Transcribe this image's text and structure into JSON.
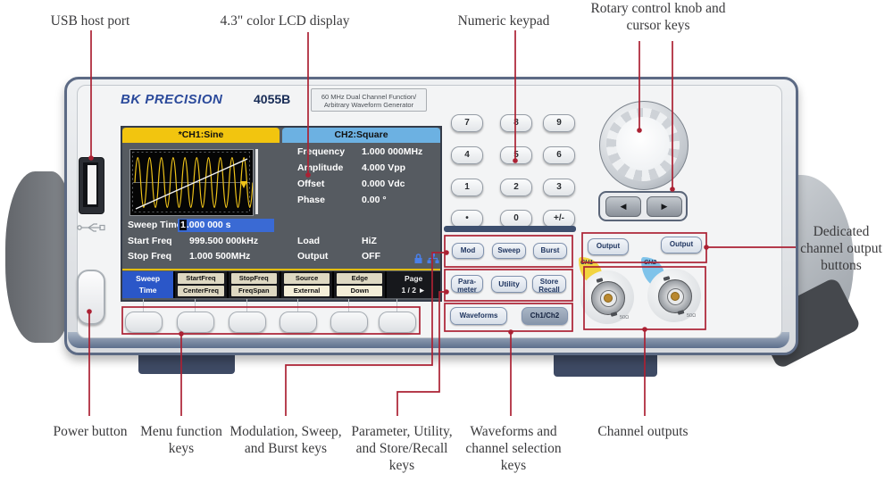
{
  "colors": {
    "annotation": "#ab2133",
    "lcd_tab_ch1": "#f2c50f",
    "lcd_tab_ch2": "#6cb1e2",
    "softkey_selected": "#2b57c8",
    "softkey_chip": "#ded8c2",
    "value_highlight": "#3a6ad4",
    "waveform": "#f0c419"
  },
  "callouts": {
    "usb": "USB host port",
    "lcd": "4.3\" color LCD display",
    "keypad": "Numeric keypad",
    "knob": "Rotary control knob and cursor keys",
    "power": "Power button",
    "menu": "Menu function keys",
    "mod": "Modulation, Sweep, and Burst keys",
    "parameter": "Parameter, Utility, and Store/Recall keys",
    "waveforms": "Waveforms and channel selection keys",
    "channel_outputs": "Channel outputs",
    "dedicated": "Dedicated channel output buttons"
  },
  "device": {
    "brand": "BK PRECISION",
    "model": "4055B",
    "subtitle_line1": "60 MHz Dual Channel Function/",
    "subtitle_line2": "Arbitrary Waveform Generator"
  },
  "lcd": {
    "tab_ch1": "*CH1:Sine",
    "tab_ch2": "CH2:Square",
    "params": [
      {
        "label": "Frequency",
        "value": "1.000 000MHz"
      },
      {
        "label": "Amplitude",
        "value": "4.000 Vpp"
      },
      {
        "label": "Offset",
        "value": "0.000 Vdc"
      },
      {
        "label": "Phase",
        "value": "0.00 °"
      }
    ],
    "sweep_time_label": "Sweep Time",
    "sweep_time_cursor": "1",
    "sweep_time_rest": ".000 000 s",
    "row2": {
      "label": "Start Freq",
      "value": "999.500 000kHz",
      "label2": "Load",
      "value2": "HiZ"
    },
    "row3": {
      "label": "Stop Freq",
      "value": "1.000 500MHz",
      "label2": "Output",
      "value2": "OFF"
    },
    "softkeys": [
      {
        "top": "Sweep",
        "bottom": "Time"
      },
      {
        "top": "StartFreq",
        "bottom": "CenterFreq"
      },
      {
        "top": "StopFreq",
        "bottom": "FreqSpan"
      },
      {
        "top": "Source",
        "bottom": "External"
      },
      {
        "top": "Edge",
        "bottom": "Down"
      },
      {
        "top": "Page",
        "bottom": "1 / 2  ►"
      }
    ]
  },
  "keypad": {
    "keys": [
      [
        "7",
        "8",
        "9"
      ],
      [
        "4",
        "5",
        "6"
      ],
      [
        "1",
        "2",
        "3"
      ],
      [
        "•",
        "0",
        "+/-"
      ]
    ]
  },
  "cursor": {
    "left": "◀",
    "right": "▶"
  },
  "function_keys": {
    "row1": [
      "Mod",
      "Sweep",
      "Burst"
    ],
    "row2_1a": "Para-",
    "row2_1b": "meter",
    "row2_2": "Utility",
    "row2_3a": "Store",
    "row2_3b": "Recall",
    "row3_1": "Waveforms",
    "row3_2": "Ch1/Ch2"
  },
  "outputs": {
    "button": "Output",
    "ch1": "CH1",
    "ch2": "CH2",
    "impedance": "50Ω"
  }
}
